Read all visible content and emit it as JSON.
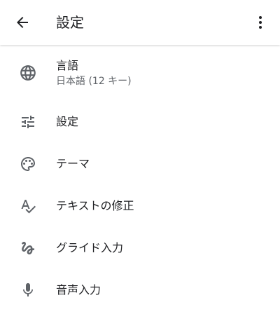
{
  "header": {
    "title": "設定",
    "back_icon": "arrow-back-icon",
    "more_icon": "more-vert-icon"
  },
  "items": [
    {
      "label": "言語",
      "sublabel": "日本語 (12 キー)",
      "icon": "globe-icon"
    },
    {
      "label": "設定",
      "icon": "tune-icon"
    },
    {
      "label": "テーマ",
      "icon": "palette-icon"
    },
    {
      "label": "テキストの修正",
      "icon": "spellcheck-icon"
    },
    {
      "label": "グライド入力",
      "icon": "gesture-icon"
    },
    {
      "label": "音声入力",
      "icon": "mic-icon"
    }
  ],
  "colors": {
    "icon": "#5f6368",
    "text_primary": "#202124",
    "text_secondary": "#5f6368"
  }
}
